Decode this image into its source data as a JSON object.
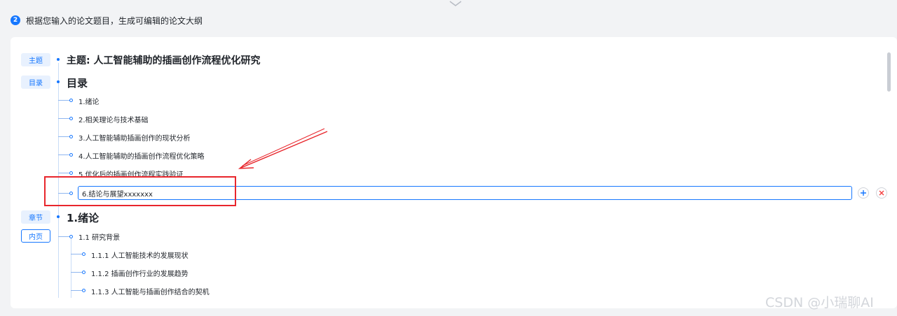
{
  "step": {
    "number": "2",
    "text": "根据您输入的论文题目，生成可编辑的论文大纲"
  },
  "tags": {
    "topic": "主题",
    "toc": "目录",
    "chapter": "章节",
    "inner": "内页"
  },
  "outline": {
    "topic_title": "主题: 人工智能辅助的插画创作流程优化研究",
    "toc_title": "目录",
    "toc_items": [
      "1.绪论",
      "2.相关理论与技术基础",
      "3.人工智能辅助插画创作的现状分析",
      "4.人工智能辅助的插画创作流程优化策略",
      "5.优化后的插画创作流程实践验证"
    ],
    "editing_value": "6.结论与展望xxxxxxx",
    "chapter_title": "1.绪论",
    "section": "1.1 研究背景",
    "subsections": [
      "1.1.1 人工智能技术的发展现状",
      "1.1.2 插画创作行业的发展趋势",
      "1.1.3 人工智能与插画创作结合的契机"
    ]
  },
  "icons": {
    "add": "plus-circle-icon",
    "remove": "close-circle-icon",
    "collapse": "chevron-down-icon"
  },
  "colors": {
    "accent": "#1677ff",
    "annotation": "#e8262c",
    "remove": "#f53f3f"
  },
  "watermark": "CSDN @小瑞聊AI"
}
